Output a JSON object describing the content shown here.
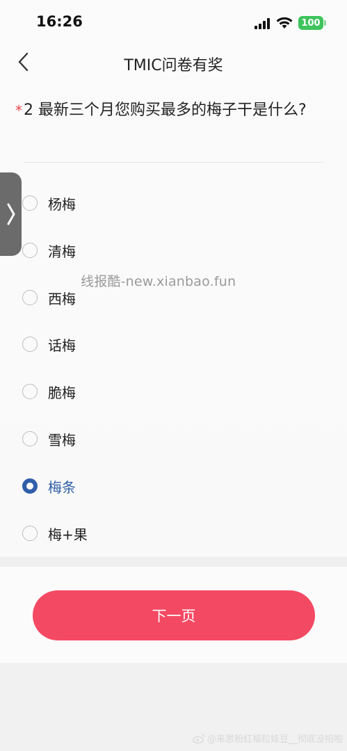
{
  "status_bar": {
    "time": "16:26",
    "battery_level": "100",
    "battery_color": "#3dc45c"
  },
  "nav": {
    "title": "TMIC问卷有奖",
    "back_icon": "chevron-left-icon"
  },
  "question": {
    "required_mark": "*",
    "text": "2 最新三个月您购买最多的梅子干是什么?"
  },
  "options": [
    {
      "label": "杨梅",
      "selected": false
    },
    {
      "label": "清梅",
      "selected": false
    },
    {
      "label": "西梅",
      "selected": false
    },
    {
      "label": "话梅",
      "selected": false
    },
    {
      "label": "脆梅",
      "selected": false
    },
    {
      "label": "雪梅",
      "selected": false
    },
    {
      "label": "梅条",
      "selected": true
    },
    {
      "label": "梅+果",
      "selected": false
    }
  ],
  "side_tab": {
    "icon": "chevron-right-icon",
    "glyph": "❭"
  },
  "watermark": "线报酷-new.xianbao.fun",
  "footer": {
    "next_label": "下一页",
    "accent": "#f44963"
  },
  "selected_color": "#2f5fa8",
  "bottom_watermark": "@来思粉红福粒娃豆__彻底没招啦"
}
